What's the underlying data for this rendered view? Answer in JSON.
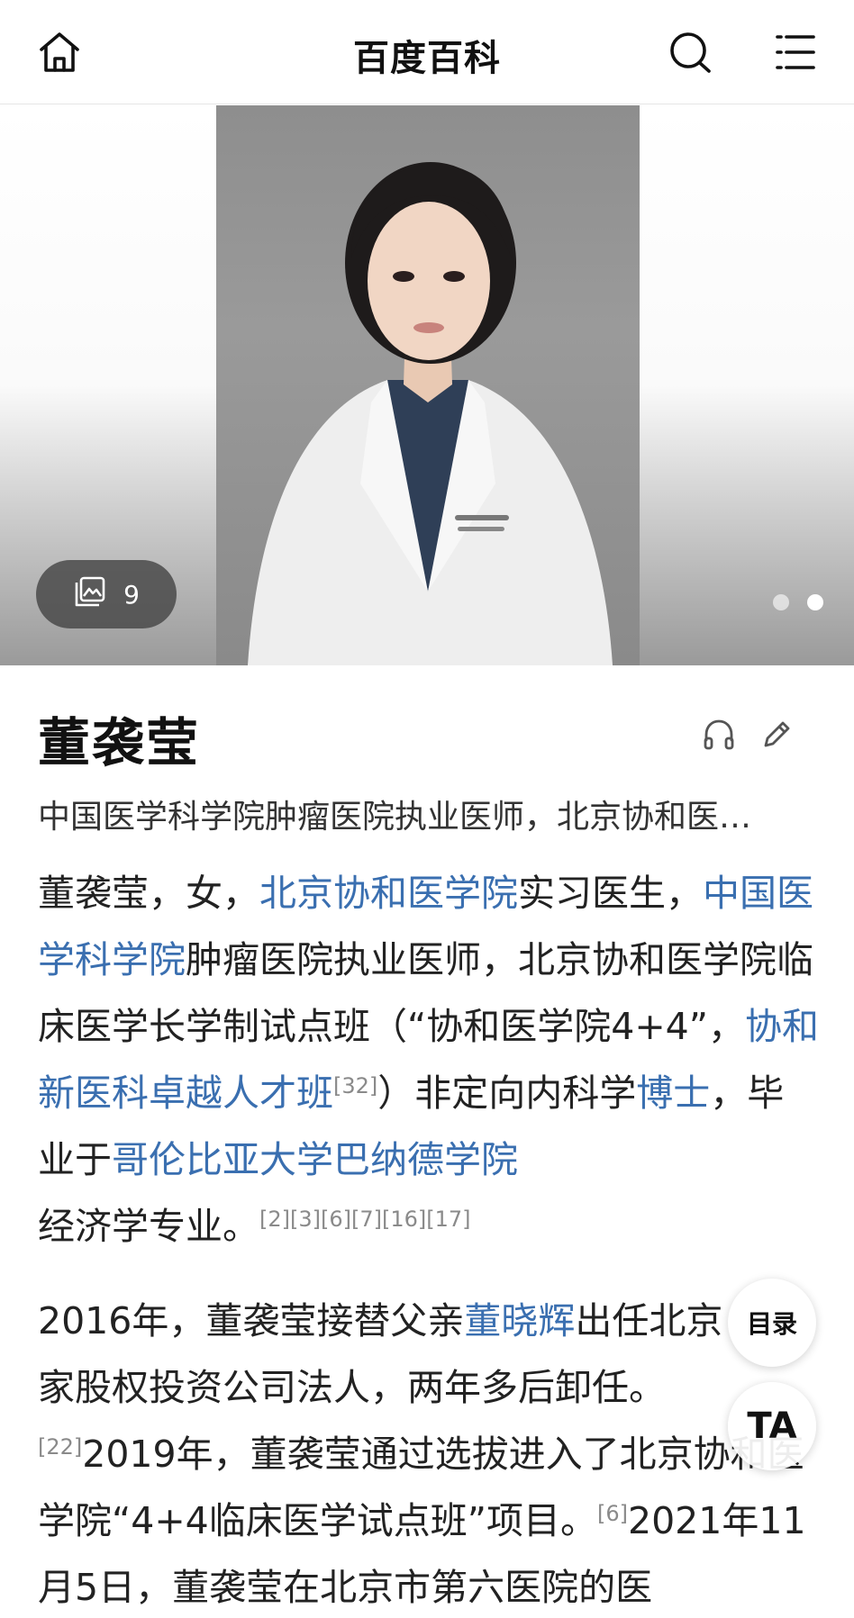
{
  "topbar": {
    "title": "百度百科",
    "icons": [
      "home-icon",
      "search-icon",
      "menu-icon"
    ]
  },
  "gallery": {
    "count": "9",
    "page_indicator": {
      "pages": 2,
      "current": 2
    }
  },
  "article": {
    "name": "董袭莹",
    "subtitle": "中国医学科学院肿瘤医院执业医师，北京协和医…",
    "para1": {
      "t1": "董袭莹，女，",
      "l1": "北京协和医学院",
      "t2": "实习医生，",
      "l2": "中国医学科学院",
      "t3": "肿瘤医院执业医师，北京协和医学院临床医学长学制试点班（“协和医学院4+4”，",
      "l3": "协和新医科卓越人才班",
      "r1": "[32]",
      "t4": "）非定向内科学",
      "l4": "博士",
      "t5": "，毕业于",
      "l5": "哥伦比亚大学巴纳德学院",
      "t6": "经济学专业。",
      "r2": "[2][3][6][7][16][17]"
    },
    "para2": {
      "t1": "2016年，董袭莹接替父亲",
      "l1": "董晓辉",
      "t2": "出任北京",
      "t3": "家股权投资公司法人，两年多后卸任。",
      "r1": "[22]",
      "t4": "2019年，董袭莹通过选拔进入了北京协和医学院“4+4临床医学试点班”项目。",
      "r2": "[6]",
      "t5": "2021年11月5日，董袭莹在北京市第六医院的医"
    }
  },
  "floating": {
    "toc_label": "目录",
    "ta_label": "TA"
  },
  "colors": {
    "link": "#3a6fb0",
    "ref": "#8a8a8a"
  }
}
